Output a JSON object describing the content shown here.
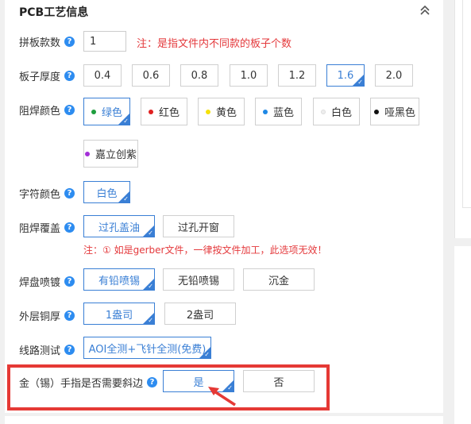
{
  "section": {
    "title": "PCB工艺信息"
  },
  "panel_qty": {
    "label": "拼板款数",
    "value": "1",
    "note": "注：是指文件内不同款的板子个数"
  },
  "thickness": {
    "label": "板子厚度",
    "options": [
      "0.4",
      "0.6",
      "0.8",
      "1.0",
      "1.2",
      "1.6",
      "2.0"
    ],
    "selected": "1.6"
  },
  "solder_mask": {
    "label": "阻焊颜色",
    "options": [
      {
        "label": "绿色",
        "color": "#1e9e3e"
      },
      {
        "label": "红色",
        "color": "#e02020"
      },
      {
        "label": "黄色",
        "color": "#f5e10a"
      },
      {
        "label": "蓝色",
        "color": "#1e88e5"
      },
      {
        "label": "白色",
        "color": "#eeeeee"
      },
      {
        "label": "哑黑色",
        "color": "#111111"
      },
      {
        "label": "嘉立创紫",
        "color": "#a32ed8"
      }
    ],
    "selected": "绿色"
  },
  "silkscreen": {
    "label": "字符颜色",
    "options": [
      "白色"
    ],
    "selected": "白色"
  },
  "mask_cover": {
    "label": "阻焊覆盖",
    "options": [
      "过孔盖油",
      "过孔开窗"
    ],
    "selected": "过孔盖油",
    "note": "注：① 如是gerber文件，一律按文件加工，此选项无效！"
  },
  "surface_finish": {
    "label": "焊盘喷镀",
    "options": [
      "有铅喷锡",
      "无铅喷锡",
      "沉金"
    ],
    "selected": "有铅喷锡"
  },
  "copper": {
    "label": "外层铜厚",
    "options": [
      "1盎司",
      "2盎司"
    ],
    "selected": "1盎司"
  },
  "test": {
    "label": "线路测试",
    "options": [
      "AOI全测+飞针全测(免费)"
    ],
    "selected": "AOI全测+飞针全测(免费)"
  },
  "bevel": {
    "label": "金（锡）手指是否需要斜边",
    "options": [
      "是",
      "否"
    ],
    "selected": "是"
  },
  "colors": {
    "accent": "#3a7fd5",
    "highlight": "#e53935",
    "note": "#e4393c"
  }
}
